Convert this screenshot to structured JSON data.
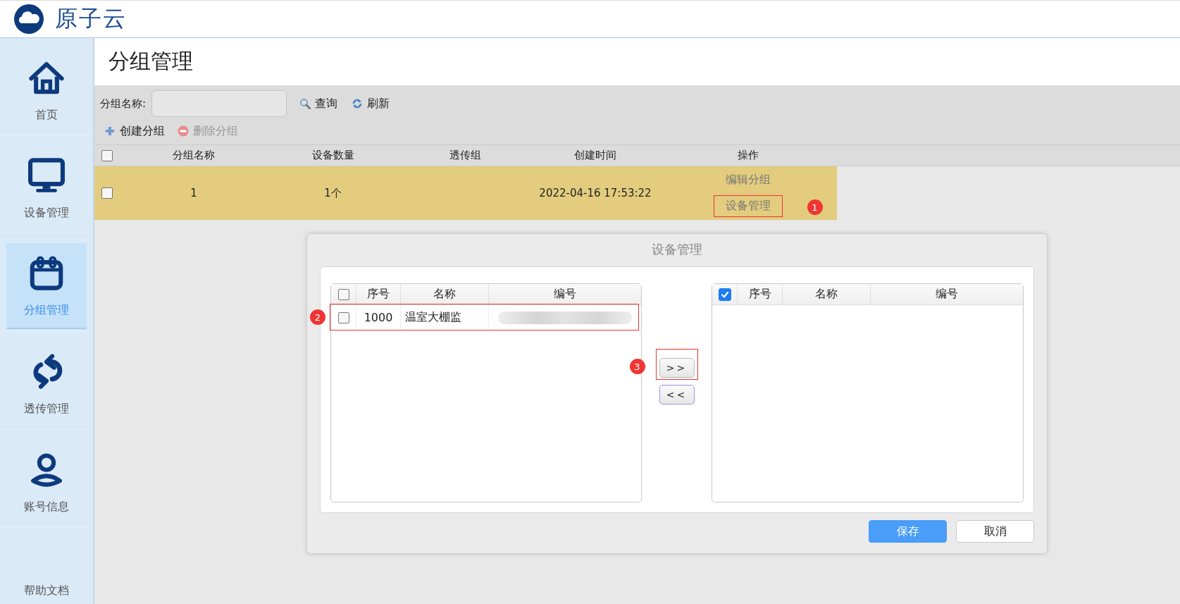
{
  "app": {
    "name": "原子云"
  },
  "sidebar": {
    "items": [
      {
        "label": "首页",
        "kind": "home",
        "selected": false
      },
      {
        "label": "设备管理",
        "kind": "monitor",
        "selected": false
      },
      {
        "label": "分组管理",
        "kind": "calendar",
        "selected": true
      },
      {
        "label": "透传管理",
        "kind": "sync",
        "selected": false
      },
      {
        "label": "账号信息",
        "kind": "user",
        "selected": false
      },
      {
        "label": "帮助文档",
        "kind": "text",
        "selected": false
      }
    ]
  },
  "page_title": "分组管理",
  "filter": {
    "label": "分组名称:",
    "buttons": [
      {
        "label": "查询",
        "kind": "search"
      },
      {
        "label": "刷新",
        "kind": "refresh"
      }
    ]
  },
  "actions": [
    {
      "label": "创建分组",
      "kind": "add",
      "disabled": false
    },
    {
      "label": "删除分组",
      "kind": "delete",
      "disabled": true
    }
  ],
  "table": {
    "all_checked": false,
    "columns": [
      "分组名称",
      "设备数量",
      "透传组",
      "创建时间",
      "操作"
    ],
    "rows": [
      {
        "checked": false,
        "selected": true,
        "name": "1",
        "count": "1个",
        "created": "2022-04-16 17:53:22",
        "actions": [
          {
            "label": "编辑分组"
          },
          {
            "label": "设备管理",
            "annotation": "1"
          }
        ]
      }
    ]
  },
  "dialog": {
    "title": "设备管理",
    "available": {
      "all_checked": false,
      "columns": [
        "序号",
        "名称",
        "编号"
      ],
      "rows": [
        {
          "checked": false,
          "index": "1000",
          "name": "温室大棚监",
          "code_redacted": true,
          "annotation": "2"
        }
      ]
    },
    "move_buttons": [
      {
        "label": ">>",
        "focused": false,
        "annotation": "3"
      },
      {
        "label": "<<",
        "focused": true
      }
    ],
    "chosen": {
      "all_checked": true,
      "columns": [
        "序号",
        "名称",
        "编号"
      ]
    },
    "buttons": [
      {
        "label": "保存",
        "kind": "primary"
      },
      {
        "label": "取消",
        "kind": "secondary"
      }
    ]
  }
}
